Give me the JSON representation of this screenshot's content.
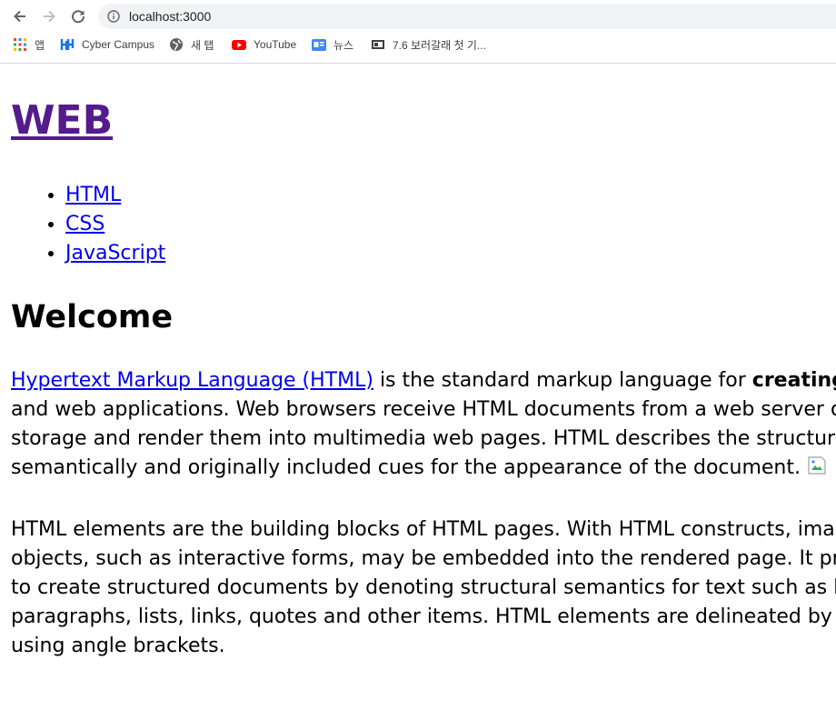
{
  "browser": {
    "url": "localhost:3000",
    "bookmarks": [
      {
        "label": "앱",
        "icon": "apps-grid-icon"
      },
      {
        "label": "Cyber Campus",
        "icon": "cyber-campus-icon"
      },
      {
        "label": "새 탭",
        "icon": "globe-icon"
      },
      {
        "label": "YouTube",
        "icon": "youtube-icon"
      },
      {
        "label": "뉴스",
        "icon": "google-news-icon"
      },
      {
        "label": "7.6 보러갈래 첫 기...",
        "icon": "tv-icon"
      }
    ]
  },
  "page": {
    "site_title": "WEB",
    "nav": [
      "HTML",
      "CSS",
      "JavaScript"
    ],
    "heading": "Welcome",
    "para1": {
      "link": "Hypertext Markup Language (HTML)",
      "text_a": " is the standard markup language for ",
      "bold": "creating web pages",
      "text_b": " and web applications. Web browsers receive HTML documents from a web server or from local storage and render them into multimedia web pages. HTML describes the structure of a web page semantically and originally included cues for the appearance of the document. "
    },
    "para2": "HTML elements are the building blocks of HTML pages. With HTML constructs, images and other objects, such as interactive forms, may be embedded into the rendered page. It provides a means to create structured documents by denoting structural semantics for text such as headings, paragraphs, lists, links, quotes and other items. HTML elements are delineated by tags, written using angle brackets."
  },
  "colors": {
    "visited_link": "#551a8b",
    "link": "#0000ee",
    "omnibox_bg": "#f1f3f4"
  }
}
